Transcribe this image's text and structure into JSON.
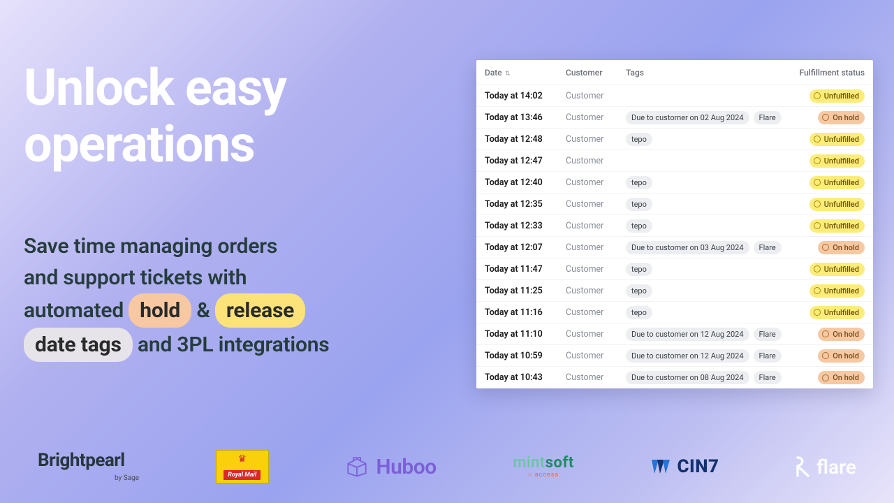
{
  "headline_line1": "Unlock easy",
  "headline_line2": "operations",
  "sub_p1": "Save time managing orders",
  "sub_p2": "and support tickets with",
  "sub_p3a": "automated ",
  "sub_hold": "hold",
  "sub_amp": " & ",
  "sub_release": "release",
  "sub_datetags": "date tags",
  "sub_p4": " and 3PL integrations",
  "table": {
    "headers": {
      "date": "Date",
      "customer": "Customer",
      "tags": "Tags",
      "status": "Fulfillment status"
    },
    "rows": [
      {
        "date": "Today at 14:02",
        "customer": "Customer",
        "tags": [],
        "status": "Unfulfilled",
        "status_kind": "unfulfilled"
      },
      {
        "date": "Today at 13:46",
        "customer": "Customer",
        "tags": [
          "Due to customer on 02 Aug 2024",
          "Flare"
        ],
        "status": "On hold",
        "status_kind": "onhold"
      },
      {
        "date": "Today at 12:48",
        "customer": "Customer",
        "tags": [
          "tepo"
        ],
        "status": "Unfulfilled",
        "status_kind": "unfulfilled"
      },
      {
        "date": "Today at 12:47",
        "customer": "Customer",
        "tags": [],
        "status": "Unfulfilled",
        "status_kind": "unfulfilled"
      },
      {
        "date": "Today at 12:40",
        "customer": "Customer",
        "tags": [
          "tepo"
        ],
        "status": "Unfulfilled",
        "status_kind": "unfulfilled"
      },
      {
        "date": "Today at 12:35",
        "customer": "Customer",
        "tags": [
          "tepo"
        ],
        "status": "Unfulfilled",
        "status_kind": "unfulfilled"
      },
      {
        "date": "Today at 12:33",
        "customer": "Customer",
        "tags": [
          "tepo"
        ],
        "status": "Unfulfilled",
        "status_kind": "unfulfilled"
      },
      {
        "date": "Today at 12:07",
        "customer": "Customer",
        "tags": [
          "Due to customer on 03 Aug 2024",
          "Flare"
        ],
        "status": "On hold",
        "status_kind": "onhold"
      },
      {
        "date": "Today at 11:47",
        "customer": "Customer",
        "tags": [
          "tepo"
        ],
        "status": "Unfulfilled",
        "status_kind": "unfulfilled"
      },
      {
        "date": "Today at 11:25",
        "customer": "Customer",
        "tags": [
          "tepo"
        ],
        "status": "Unfulfilled",
        "status_kind": "unfulfilled"
      },
      {
        "date": "Today at 11:16",
        "customer": "Customer",
        "tags": [
          "tepo"
        ],
        "status": "Unfulfilled",
        "status_kind": "unfulfilled"
      },
      {
        "date": "Today at 11:10",
        "customer": "Customer",
        "tags": [
          "Due to customer on 12 Aug 2024",
          "Flare"
        ],
        "status": "On hold",
        "status_kind": "onhold"
      },
      {
        "date": "Today at 10:59",
        "customer": "Customer",
        "tags": [
          "Due to customer on 12 Aug 2024",
          "Flare"
        ],
        "status": "On hold",
        "status_kind": "onhold"
      },
      {
        "date": "Today at 10:43",
        "customer": "Customer",
        "tags": [
          "Due to customer on 08 Aug 2024",
          "Flare"
        ],
        "status": "On hold",
        "status_kind": "onhold"
      }
    ]
  },
  "logos": {
    "brightpearl": "Brightpearl",
    "brightpearl_sub": "by Sage",
    "royalmail": "Royal Mail",
    "huboo": "Huboo",
    "mintsoft_a": "m",
    "mintsoft_b": "i",
    "mintsoft_c": "nt",
    "mintsoft_d": "soft",
    "mintsoft_sub": "○ access",
    "cin7": "CIN7",
    "flare": "flare"
  }
}
